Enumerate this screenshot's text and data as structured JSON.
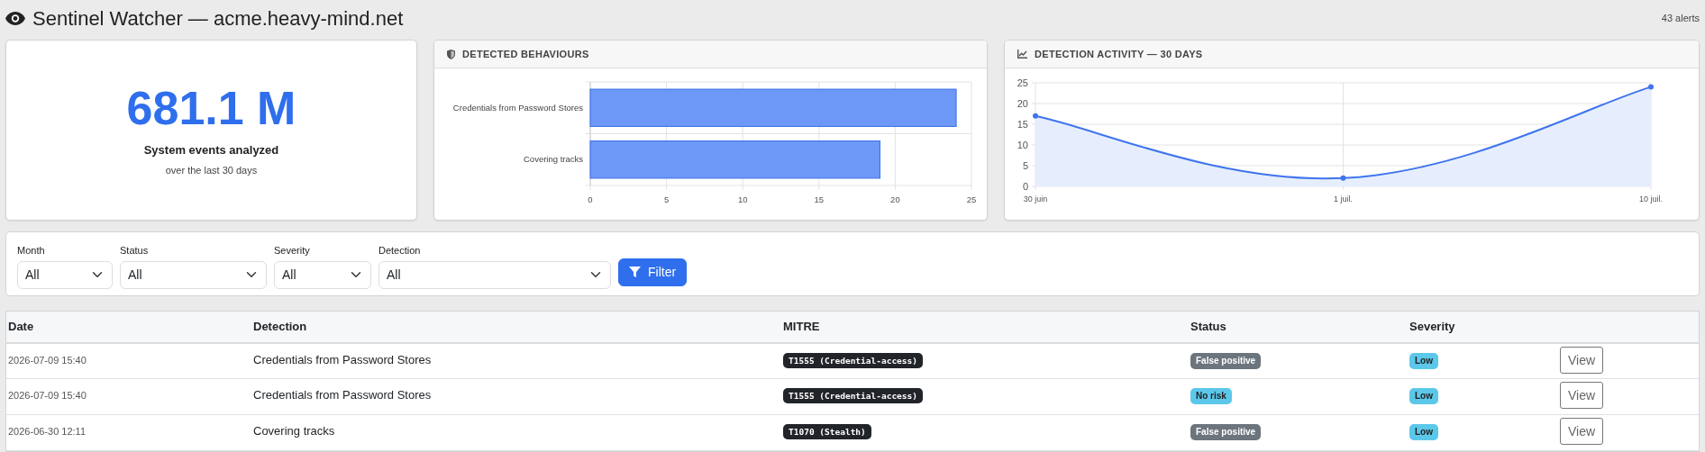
{
  "header": {
    "title": "Sentinel Watcher — acme.heavy-mind.net",
    "alert_count": "43 alerts"
  },
  "stat_card": {
    "value": "681.1 M",
    "label": "System events analyzed",
    "sublabel": "over the last 30 days"
  },
  "behaviours_panel": {
    "title": "DETECTED BEHAVIOURS",
    "chart_data": {
      "type": "bar",
      "orientation": "horizontal",
      "categories": [
        "Credentials from Password Stores",
        "Covering tracks"
      ],
      "values": [
        24,
        19
      ],
      "xlim": [
        0,
        25
      ],
      "xticks": [
        0,
        5,
        10,
        15,
        20,
        25
      ],
      "grid": true
    }
  },
  "activity_panel": {
    "title": "DETECTION ACTIVITY — 30 DAYS",
    "chart_data": {
      "type": "area",
      "categories": [
        "30 juin",
        "1 juil.",
        "10 juil."
      ],
      "values": [
        17,
        2,
        24
      ],
      "ylim": [
        0,
        25
      ],
      "yticks": [
        0,
        5,
        10,
        15,
        20,
        25
      ],
      "grid": true,
      "marker": true
    }
  },
  "filters": [
    {
      "label": "Month",
      "value": "All"
    },
    {
      "label": "Status",
      "value": "All"
    },
    {
      "label": "Severity",
      "value": "All"
    },
    {
      "label": "Detection",
      "value": "All"
    }
  ],
  "filter_button": "Filter",
  "table": {
    "columns": [
      "Date",
      "Detection",
      "MITRE",
      "Status",
      "Severity"
    ],
    "rows": [
      {
        "date": "2026-07-09 15:40",
        "detection": "Credentials from Password Stores",
        "mitre": "T1555 (Credential-access)",
        "status": {
          "text": "False positive",
          "color": "#6c757d"
        },
        "severity": {
          "text": "Low",
          "color": "#5bc8ea"
        },
        "action": "View"
      },
      {
        "date": "2026-07-09 15:40",
        "detection": "Credentials from Password Stores",
        "mitre": "T1555 (Credential-access)",
        "status": {
          "text": "No risk",
          "color": "#5bc8ea"
        },
        "severity": {
          "text": "Low",
          "color": "#5bc8ea"
        },
        "action": "View"
      },
      {
        "date": "2026-06-30 12:11",
        "detection": "Covering tracks",
        "mitre": "T1070 (Stealth)",
        "status": {
          "text": "False positive",
          "color": "#6c757d"
        },
        "severity": {
          "text": "Low",
          "color": "#5bc8ea"
        },
        "action": "View"
      }
    ]
  }
}
